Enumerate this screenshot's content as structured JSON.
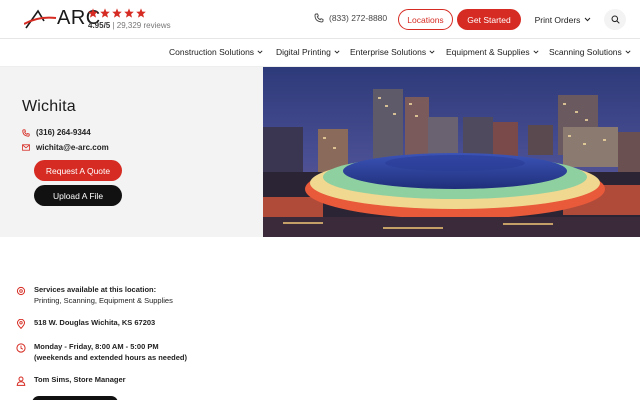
{
  "brand": {
    "logo_text": "ARC"
  },
  "rating": {
    "score": "4.95/5",
    "reviews": "| 29,329 reviews",
    "stars": 5,
    "star_color": "#d62b22"
  },
  "header": {
    "phone": "(833) 272-8880",
    "locations_label": "Locations",
    "get_started_label": "Get Started",
    "print_orders_label": "Print Orders"
  },
  "nav": {
    "items": [
      {
        "label": "Construction Solutions"
      },
      {
        "label": "Digital Printing"
      },
      {
        "label": "Enterprise Solutions"
      },
      {
        "label": "Equipment & Supplies"
      },
      {
        "label": "Scanning Solutions"
      }
    ]
  },
  "location": {
    "city": "Wichita",
    "phone": "(316) 264-9344",
    "email": "wichita@e-arc.com",
    "quote_label": "Request A Quote",
    "upload_label": "Upload A File"
  },
  "details": {
    "services_title": "Services available at this location:",
    "services_list": "Printing, Scanning, Equipment & Supplies",
    "address": "518 W. Douglas Wichita, KS 67203",
    "hours_line1": "Monday - Friday, 8:00 AM - 5:00 PM",
    "hours_line2": "(weekends and extended hours as needed)",
    "manager": "Tom Sims, Store Manager"
  },
  "colors": {
    "accent": "#d62b22",
    "dark": "#111111",
    "panel": "#f3f3f3"
  },
  "icons": [
    "phone-icon",
    "search-icon",
    "chevron-down-icon",
    "mail-icon",
    "services-icon",
    "map-pin-icon",
    "clock-icon",
    "person-icon",
    "star-icon"
  ]
}
